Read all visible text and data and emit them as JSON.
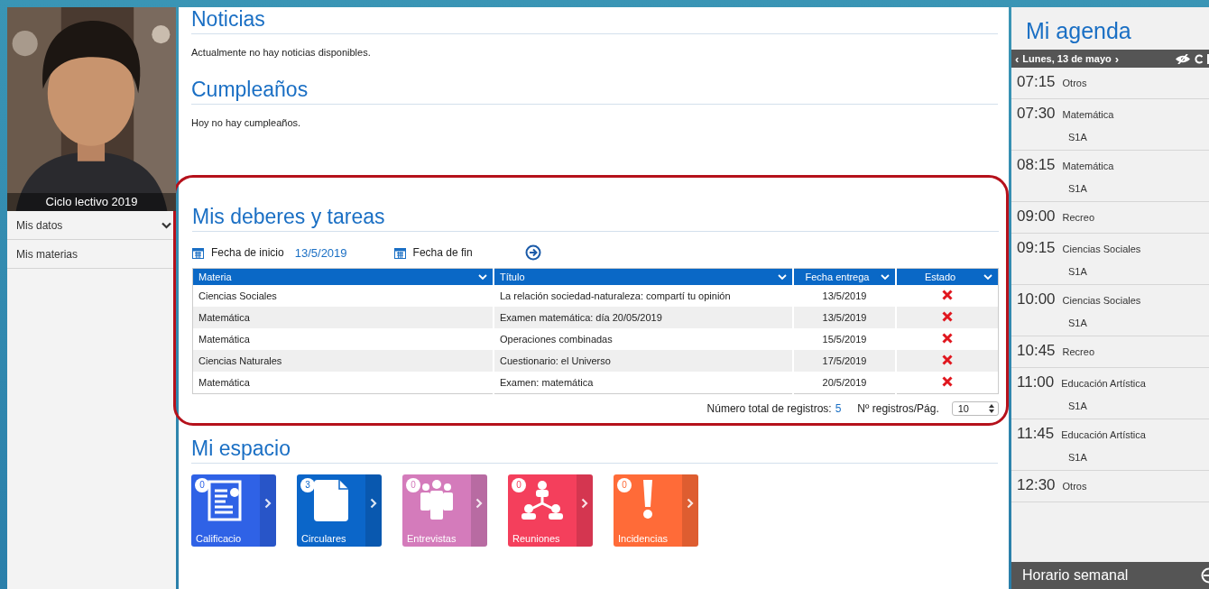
{
  "sidebar": {
    "photo": {
      "caption": "Ciclo lectivo 2019"
    },
    "menu": [
      {
        "label": "Mis datos",
        "expandable": true
      },
      {
        "label": "Mis materias",
        "expandable": false
      }
    ]
  },
  "news": {
    "title": "Noticias",
    "text": "Actualmente no hay noticias disponibles."
  },
  "birthdays": {
    "title": "Cumpleaños",
    "text": "Hoy no hay cumpleaños."
  },
  "tasks": {
    "title": "Mis deberes y tareas",
    "start_label": "Fecha de inicio",
    "start_value": "13/5/2019",
    "end_label": "Fecha de fin",
    "table": {
      "columns": [
        "Materia",
        "Título",
        "Fecha entrega",
        "Estado"
      ],
      "rows": [
        {
          "subject": "Ciencias Sociales",
          "title": "La relación sociedad-naturaleza: compartí tu opinión",
          "due": "13/5/2019",
          "done": false
        },
        {
          "subject": "Matemática",
          "title": "Examen matemática: día 20/05/2019",
          "due": "13/5/2019",
          "done": false
        },
        {
          "subject": "Matemática",
          "title": "Operaciones combinadas",
          "due": "15/5/2019",
          "done": false
        },
        {
          "subject": "Ciencias Naturales",
          "title": "Cuestionario: el Universo",
          "due": "17/5/2019",
          "done": false
        },
        {
          "subject": "Matemática",
          "title": "Examen: matemática",
          "due": "20/5/2019",
          "done": false
        }
      ]
    },
    "total_label": "Número total de registros:",
    "total_value": "5",
    "per_page_label": "Nº registros/Pág.",
    "per_page_value": "10"
  },
  "space": {
    "title": "Mi espacio",
    "tiles": [
      {
        "label": "Calificacio",
        "count": "0",
        "kind": "grades",
        "color": "#2f62e6"
      },
      {
        "label": "Circulares",
        "count": "3",
        "kind": "document",
        "color": "#0b66c9"
      },
      {
        "label": "Entrevistas",
        "count": "0",
        "kind": "people",
        "color": "#d47bbb"
      },
      {
        "label": "Reuniones",
        "count": "0",
        "kind": "network",
        "color": "#f43f5c"
      },
      {
        "label": "Incidencias",
        "count": "0",
        "kind": "alert",
        "color": "#ff6b38"
      }
    ]
  },
  "agenda": {
    "title": "Mi agenda",
    "date": "Lunes, 13 de mayo",
    "prev": "‹",
    "next": "›",
    "items": [
      {
        "time": "07:15",
        "subject": "Otros"
      },
      {
        "time": "07:30",
        "subject": "Matemática",
        "room": "S1A"
      },
      {
        "time": "08:15",
        "subject": "Matemática",
        "room": "S1A"
      },
      {
        "time": "09:00",
        "subject": "Recreo"
      },
      {
        "time": "09:15",
        "subject": "Ciencias Sociales",
        "room": "S1A"
      },
      {
        "time": "10:00",
        "subject": "Ciencias Sociales",
        "room": "S1A"
      },
      {
        "time": "10:45",
        "subject": "Recreo"
      },
      {
        "time": "11:00",
        "subject": "Educación Artística",
        "room": "S1A"
      },
      {
        "time": "11:45",
        "subject": "Educación Artística",
        "room": "S1A"
      },
      {
        "time": "12:30",
        "subject": "Otros"
      }
    ],
    "footer": "Horario semanal"
  }
}
